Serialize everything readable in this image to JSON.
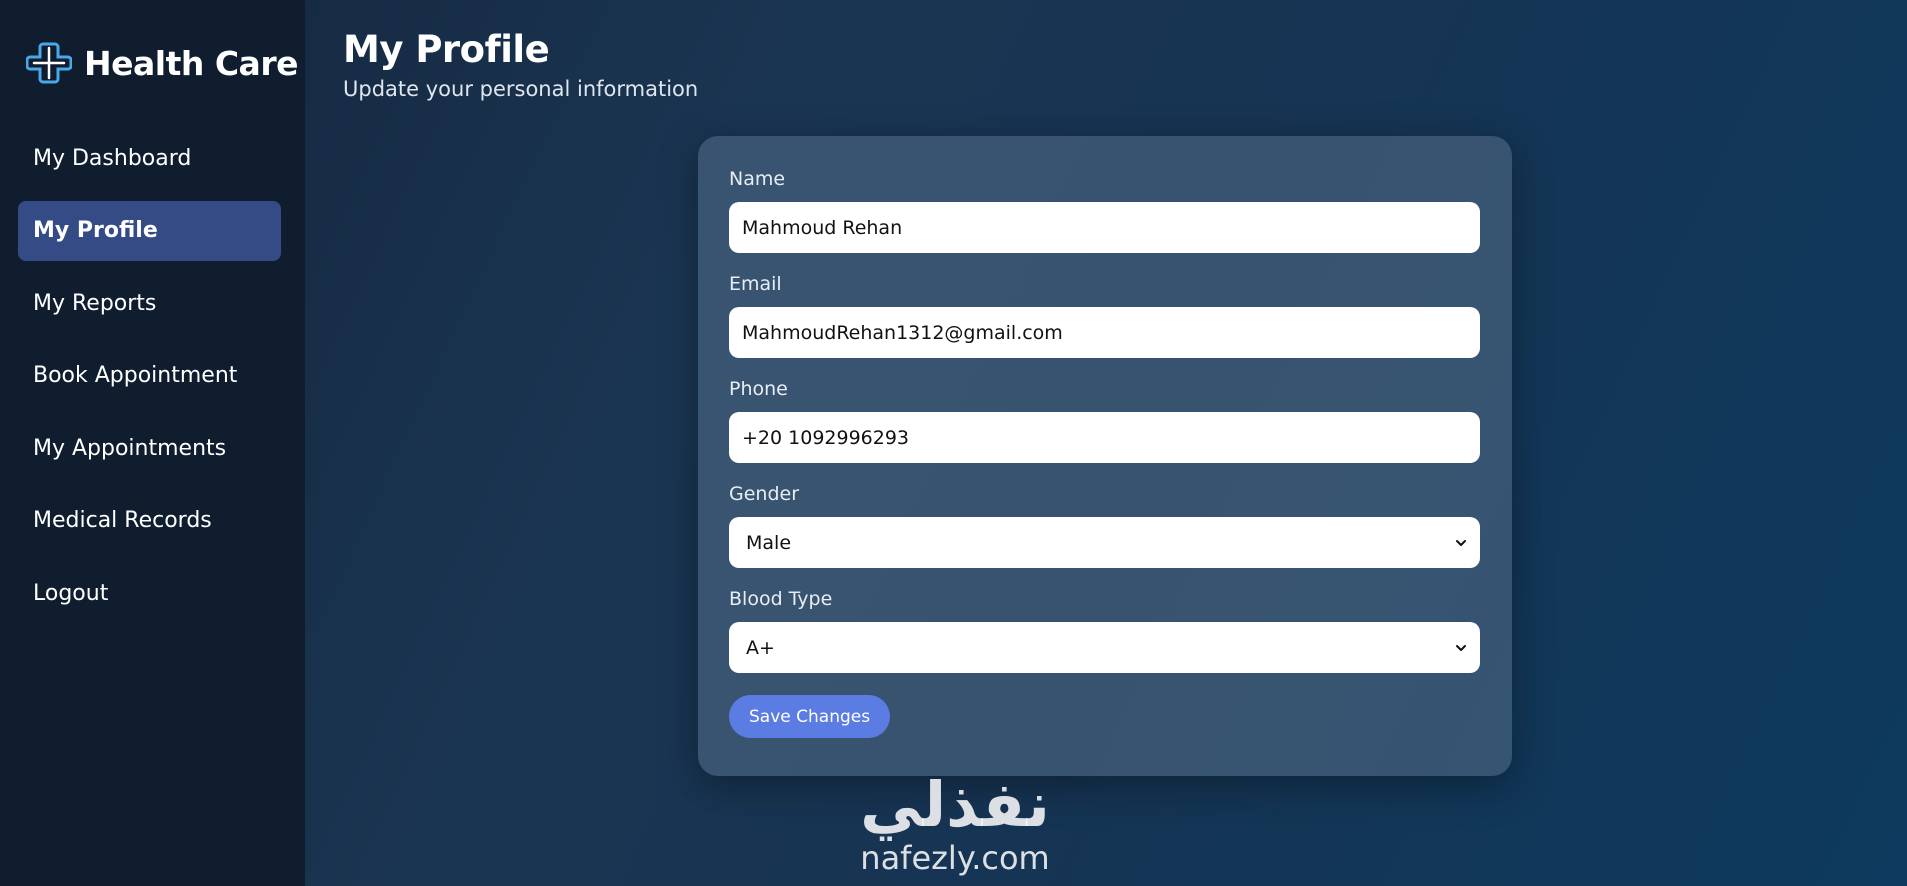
{
  "app": {
    "name": "Health Care",
    "logo_icon": "medical-cross-icon"
  },
  "sidebar": {
    "items": [
      {
        "label": "My Dashboard",
        "active": false
      },
      {
        "label": "My Profile",
        "active": true
      },
      {
        "label": "My Reports",
        "active": false
      },
      {
        "label": "Book Appointment",
        "active": false
      },
      {
        "label": "My Appointments",
        "active": false
      },
      {
        "label": "Medical Records",
        "active": false
      },
      {
        "label": "Logout",
        "active": false
      }
    ]
  },
  "header": {
    "title": "My Profile",
    "subtitle": "Update your personal information"
  },
  "form": {
    "name": {
      "label": "Name",
      "value": "Mahmoud Rehan"
    },
    "email": {
      "label": "Email",
      "value": "MahmoudRehan1312@gmail.com"
    },
    "phone": {
      "label": "Phone",
      "value": "+20 1092996293"
    },
    "gender": {
      "label": "Gender",
      "value": "Male"
    },
    "blood_type": {
      "label": "Blood Type",
      "value": "A+"
    },
    "save_label": "Save Changes"
  },
  "watermark": {
    "arabic": "نفذلي",
    "latin": "nafezly.com"
  },
  "colors": {
    "sidebar_bg": "#0f1d2f",
    "active_nav": "#344b86",
    "button": "#5b7de3",
    "card": "#4e6782"
  }
}
